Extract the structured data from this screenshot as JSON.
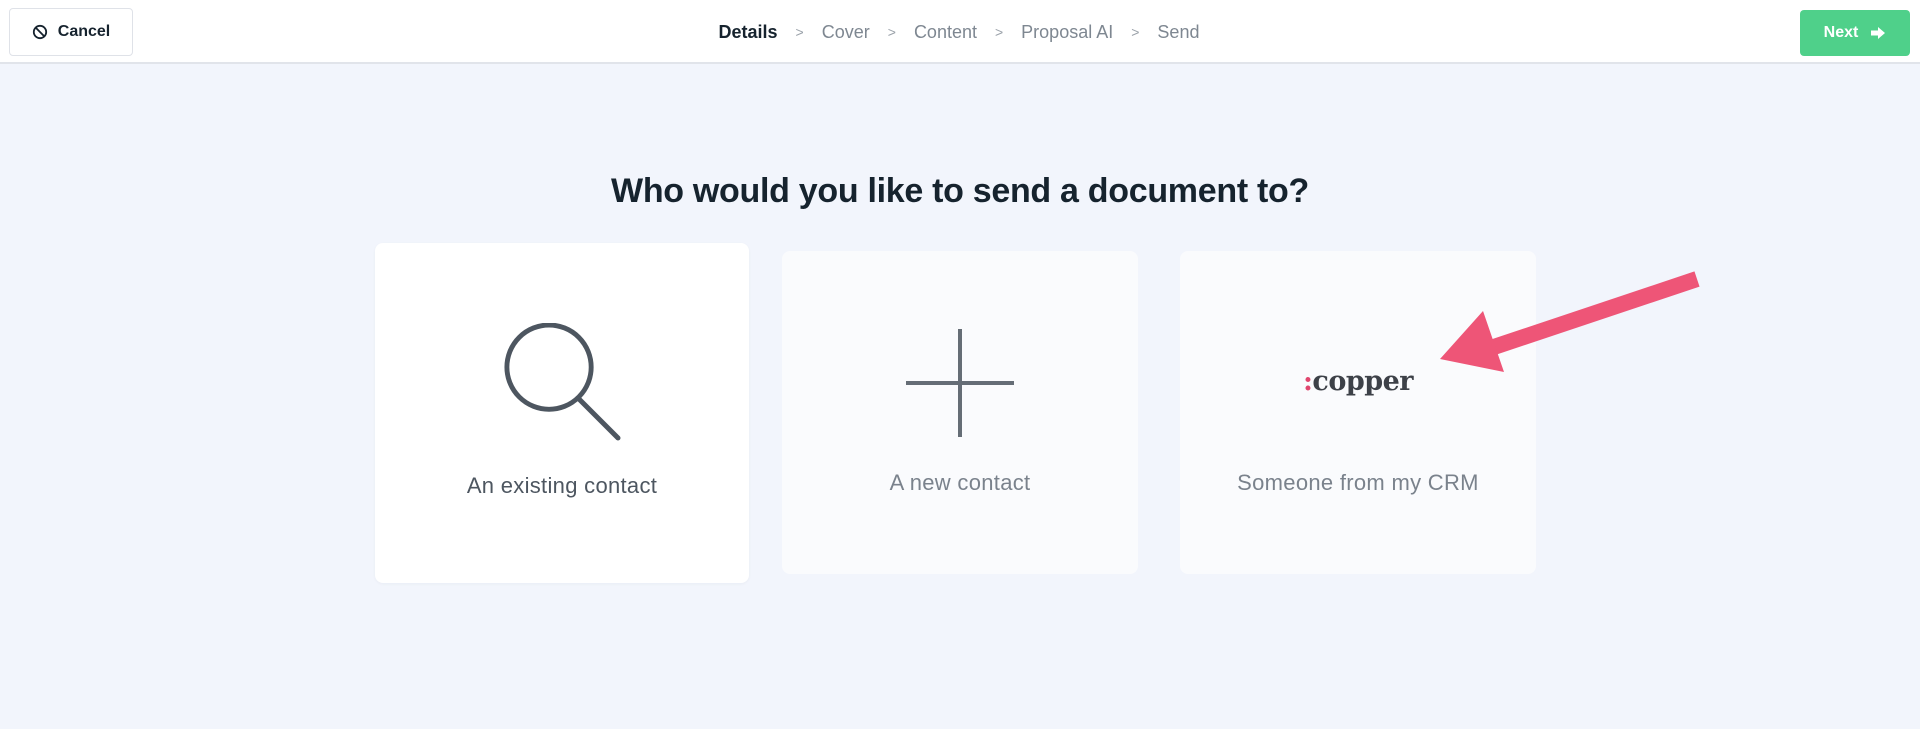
{
  "header": {
    "cancel_label": "Cancel",
    "next_label": "Next",
    "steps": [
      {
        "label": "Details",
        "active": true
      },
      {
        "label": "Cover",
        "active": false
      },
      {
        "label": "Content",
        "active": false
      },
      {
        "label": "Proposal AI",
        "active": false
      },
      {
        "label": "Send",
        "active": false
      }
    ],
    "separator": ">"
  },
  "main": {
    "question": "Who would you like to send a document to?",
    "options": [
      {
        "label": "An existing contact",
        "icon": "search-icon"
      },
      {
        "label": "A new contact",
        "icon": "plus-icon"
      },
      {
        "label": "Someone from my CRM",
        "icon": "copper-logo",
        "logo_colon": ":",
        "logo_text": "copper"
      }
    ]
  },
  "colors": {
    "accent_green": "#4fd08a",
    "arrow_pink": "#ee5577",
    "logo_colon": "#e0466e",
    "background": "#f2f5fc",
    "heading": "#16232e"
  }
}
